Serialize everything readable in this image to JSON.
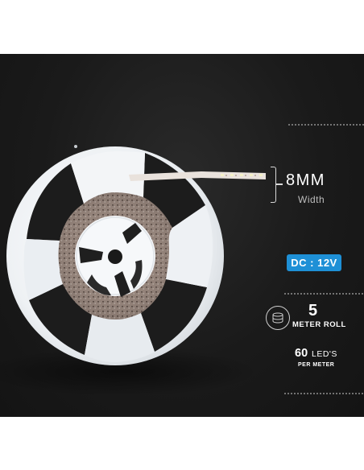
{
  "specs": {
    "width_value": "8MM",
    "width_label": "Width",
    "voltage": "DC : 12V",
    "roll_value": "5",
    "roll_label": "METER ROLL",
    "leds_value": "60",
    "leds_unit": "LED'S",
    "leds_label": "PER METER"
  },
  "colors": {
    "background": "#1a1a1a",
    "accent": "#1e90d6",
    "reel": "#f2f4f6"
  },
  "icons": {
    "roll": "led-roll-icon"
  }
}
